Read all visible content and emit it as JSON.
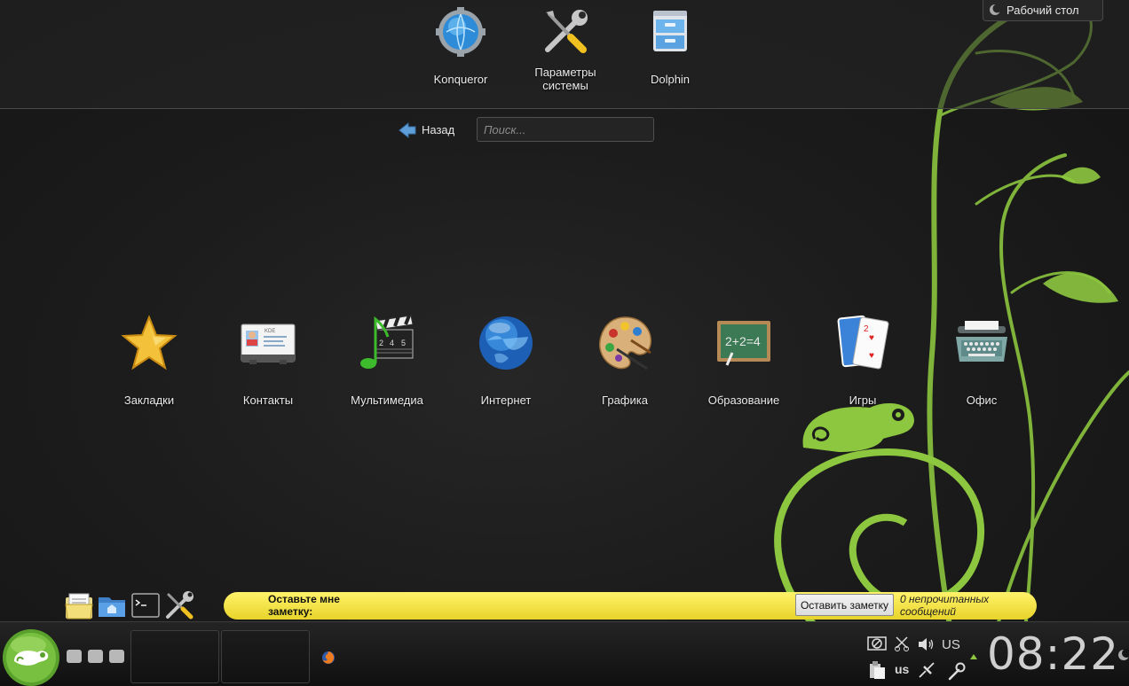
{
  "favorites": [
    {
      "label": "Konqueror",
      "icon": "globe-gear-icon"
    },
    {
      "label": "Параметры системы",
      "icon": "tools-icon"
    },
    {
      "label": "Dolphin",
      "icon": "file-cabinet-icon"
    }
  ],
  "desktop_button": {
    "label": "Рабочий стол"
  },
  "navigation": {
    "back_label": "Назад",
    "search_placeholder": "Поиск..."
  },
  "categories": [
    {
      "label": "Закладки",
      "icon": "star-icon"
    },
    {
      "label": "Контакты",
      "icon": "contact-card-icon"
    },
    {
      "label": "Мультимедиа",
      "icon": "multimedia-icon"
    },
    {
      "label": "Интернет",
      "icon": "globe-icon"
    },
    {
      "label": "Графика",
      "icon": "palette-icon"
    },
    {
      "label": "Образование",
      "icon": "chalkboard-icon"
    },
    {
      "label": "Игры",
      "icon": "cards-icon"
    },
    {
      "label": "Офис",
      "icon": "typewriter-icon"
    }
  ],
  "chalkboard_text": "2+2=4",
  "contact_card": {
    "brand": "KDE"
  },
  "note_widget": {
    "prompt": "Оставьте мне заметку:",
    "button": "Оставить заметку",
    "unread": "0 непрочитанных сообщений"
  },
  "tray": {
    "layout_upper": "US",
    "layout_lower": "us"
  },
  "clock": {
    "time": "08:22"
  },
  "colors": {
    "accent_green": "#8dc63f",
    "note_yellow": "#f5e642",
    "background": "#1c1c1c"
  }
}
